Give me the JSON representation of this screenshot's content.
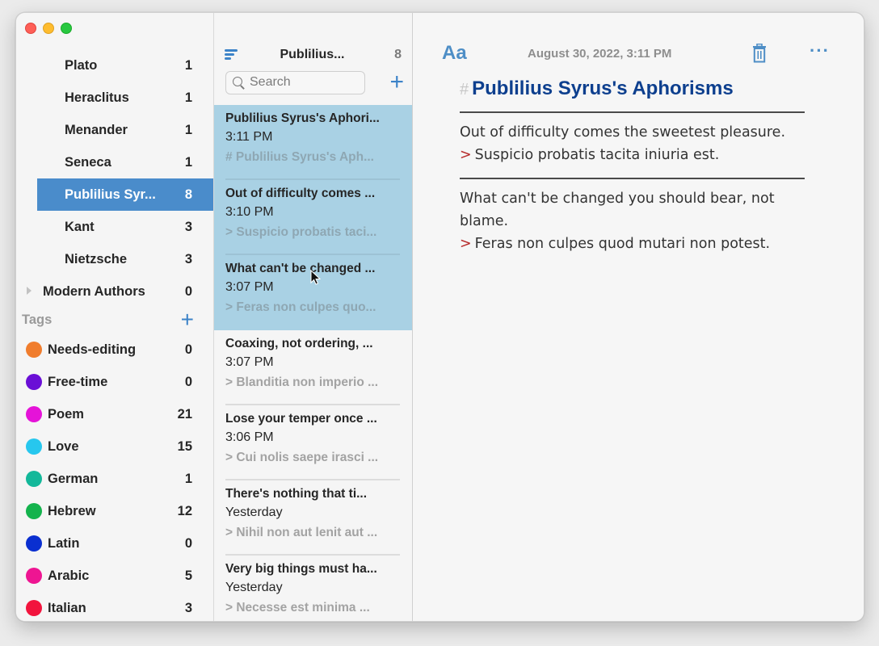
{
  "window": {
    "traffic_lights": [
      "close",
      "minimize",
      "zoom"
    ]
  },
  "sidebar": {
    "folders": [
      {
        "label": "Plato",
        "count": "1"
      },
      {
        "label": "Heraclitus",
        "count": "1"
      },
      {
        "label": "Menander",
        "count": "1"
      },
      {
        "label": "Seneca",
        "count": "1"
      },
      {
        "label": "Publilius Syr...",
        "count": "8",
        "selected": true
      },
      {
        "label": "Kant",
        "count": "3"
      },
      {
        "label": "Nietzsche",
        "count": "3"
      },
      {
        "label": "Modern Authors",
        "count": "0",
        "collapsed_group": true
      }
    ],
    "tags_header": "Tags",
    "tags": [
      {
        "label": "Needs-editing",
        "count": "0",
        "color": "#f07d2d"
      },
      {
        "label": "Free-time",
        "count": "0",
        "color": "#6a0fd6"
      },
      {
        "label": "Poem",
        "count": "21",
        "color": "#e513d8"
      },
      {
        "label": "Love",
        "count": "15",
        "color": "#27c7ee"
      },
      {
        "label": "German",
        "count": "1",
        "color": "#13b89a"
      },
      {
        "label": "Hebrew",
        "count": "12",
        "color": "#14b34d"
      },
      {
        "label": "Latin",
        "count": "0",
        "color": "#0a2fd0"
      },
      {
        "label": "Arabic",
        "count": "5",
        "color": "#ee1592"
      },
      {
        "label": "Italian",
        "count": "3",
        "color": "#f2143d"
      }
    ]
  },
  "notelist": {
    "title": "Publilius...",
    "count": "8",
    "search_placeholder": "Search",
    "notes": [
      {
        "title": "Publilius Syrus's Aphori...",
        "time": "3:11 PM",
        "preview": "# Publilius Syrus's Aph...",
        "selected": true
      },
      {
        "title": "Out of difficulty comes ...",
        "time": "3:10 PM",
        "preview": "> Suspicio probatis taci...",
        "selected": true
      },
      {
        "title": "What can't be changed ...",
        "time": "3:07 PM",
        "preview": "> Feras non culpes quo...",
        "selected": true
      },
      {
        "title": "Coaxing, not ordering, ...",
        "time": "3:07 PM",
        "preview": "> Blanditia non imperio ..."
      },
      {
        "title": "Lose your temper once ...",
        "time": "3:06 PM",
        "preview": "> Cui nolis saepe irasci ..."
      },
      {
        "title": "There's nothing that ti...",
        "time": "Yesterday",
        "preview": "> Nihil non aut lenit aut ..."
      },
      {
        "title": "Very big things must ha...",
        "time": "Yesterday",
        "preview": "> Necesse est minima ..."
      }
    ]
  },
  "editor": {
    "format_label": "Aa",
    "date": "August 30, 2022, 3:11 PM",
    "heading_mark": "#",
    "heading": "Publilius Syrus's Aphorisms",
    "blocks": [
      {
        "text": "Out of difficulty comes the sweetest pleasure.",
        "quote": "Suspicio probatis tacita iniuria est."
      },
      {
        "text": "What can't be changed you should bear, not blame.",
        "quote": "Feras non culpes quod mutari non potest."
      }
    ],
    "quote_mark": ">",
    "colors": {
      "accent": "#4e8ec6",
      "heading": "#0d3f8e",
      "quote_mark": "#b62b2b",
      "selection": "#a9d1e4",
      "sidebar_selection": "#4a8ccb"
    }
  }
}
